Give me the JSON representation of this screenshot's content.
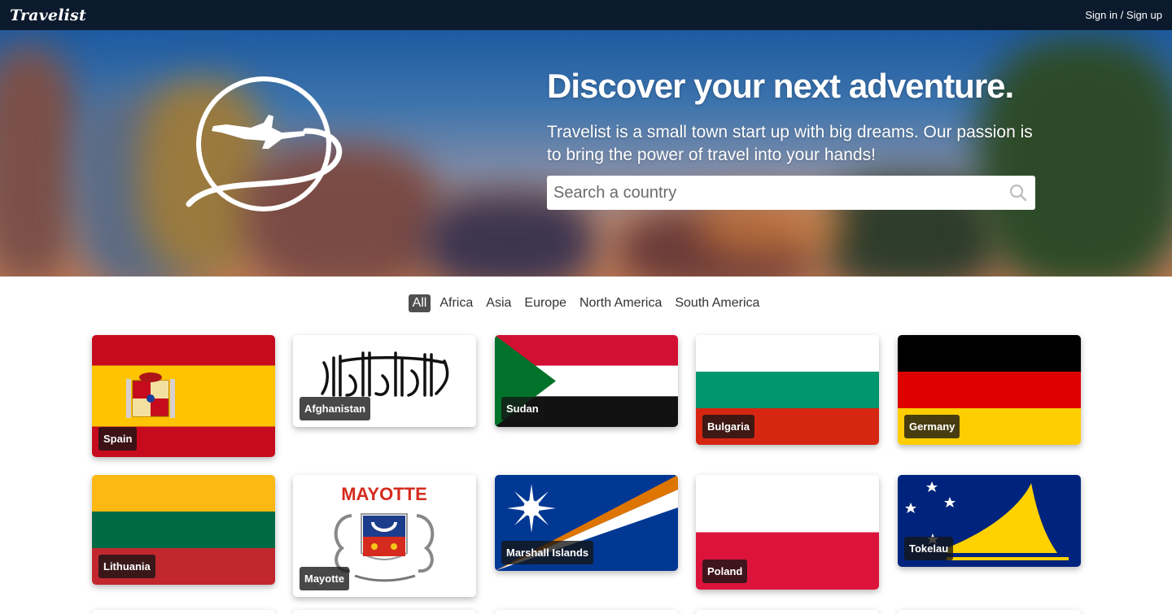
{
  "navbar": {
    "brand": "Travelist",
    "signin": "Sign in / Sign up"
  },
  "hero": {
    "title": "Discover your next adventure.",
    "subtitle": "Travelist is a small town start up with big dreams. Our passion is to bring the power of travel into your hands!",
    "search_placeholder": "Search a country"
  },
  "filters": [
    "All",
    "Africa",
    "Asia",
    "Europe",
    "North America",
    "South America"
  ],
  "active_filter": "All",
  "countries": [
    "Spain",
    "Afghanistan",
    "Sudan",
    "Bulgaria",
    "Germany",
    "Lithuania",
    "Mayotte",
    "Marshall Islands",
    "Poland",
    "Tokelau"
  ],
  "mayotte_flag_text": "MAYOTTE",
  "colors": {
    "navbar": "#0b1a2c",
    "active_filter": "#4f4f4f",
    "label_bg": "#141414"
  }
}
